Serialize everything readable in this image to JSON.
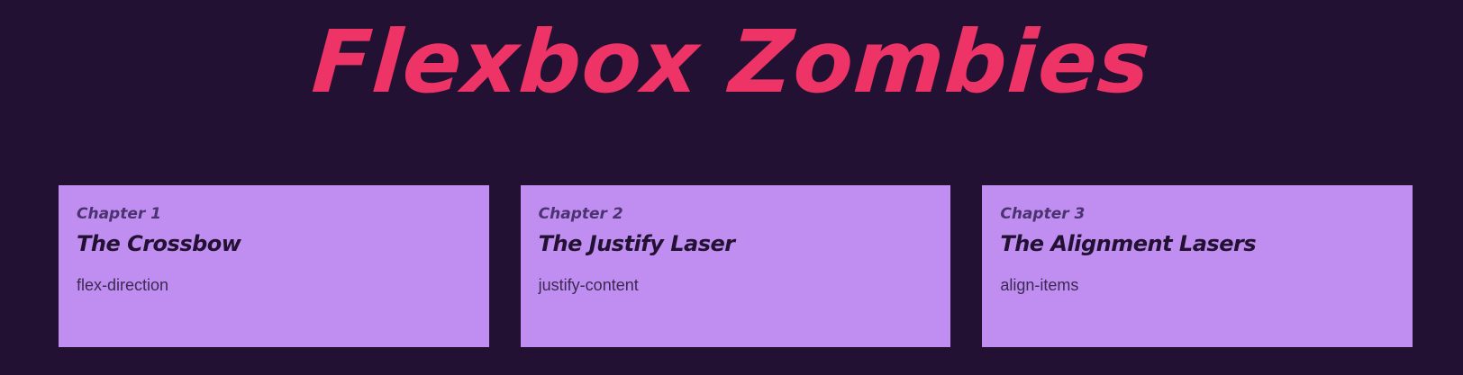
{
  "header": {
    "title": "Flexbox Zombies"
  },
  "chapters": [
    {
      "label": "Chapter 1",
      "title": "The Crossbow",
      "topic": "flex-direction"
    },
    {
      "label": "Chapter 2",
      "title": "The Justify Laser",
      "topic": "justify-content"
    },
    {
      "label": "Chapter 3",
      "title": "The Alignment Lasers",
      "topic": "align-items"
    }
  ],
  "colors": {
    "background": "#221133",
    "title": "#ee3466",
    "card": "#c08ef0",
    "chapter_label": "#4b3370",
    "chapter_title": "#221133",
    "topic_text": "#3a2a52"
  }
}
